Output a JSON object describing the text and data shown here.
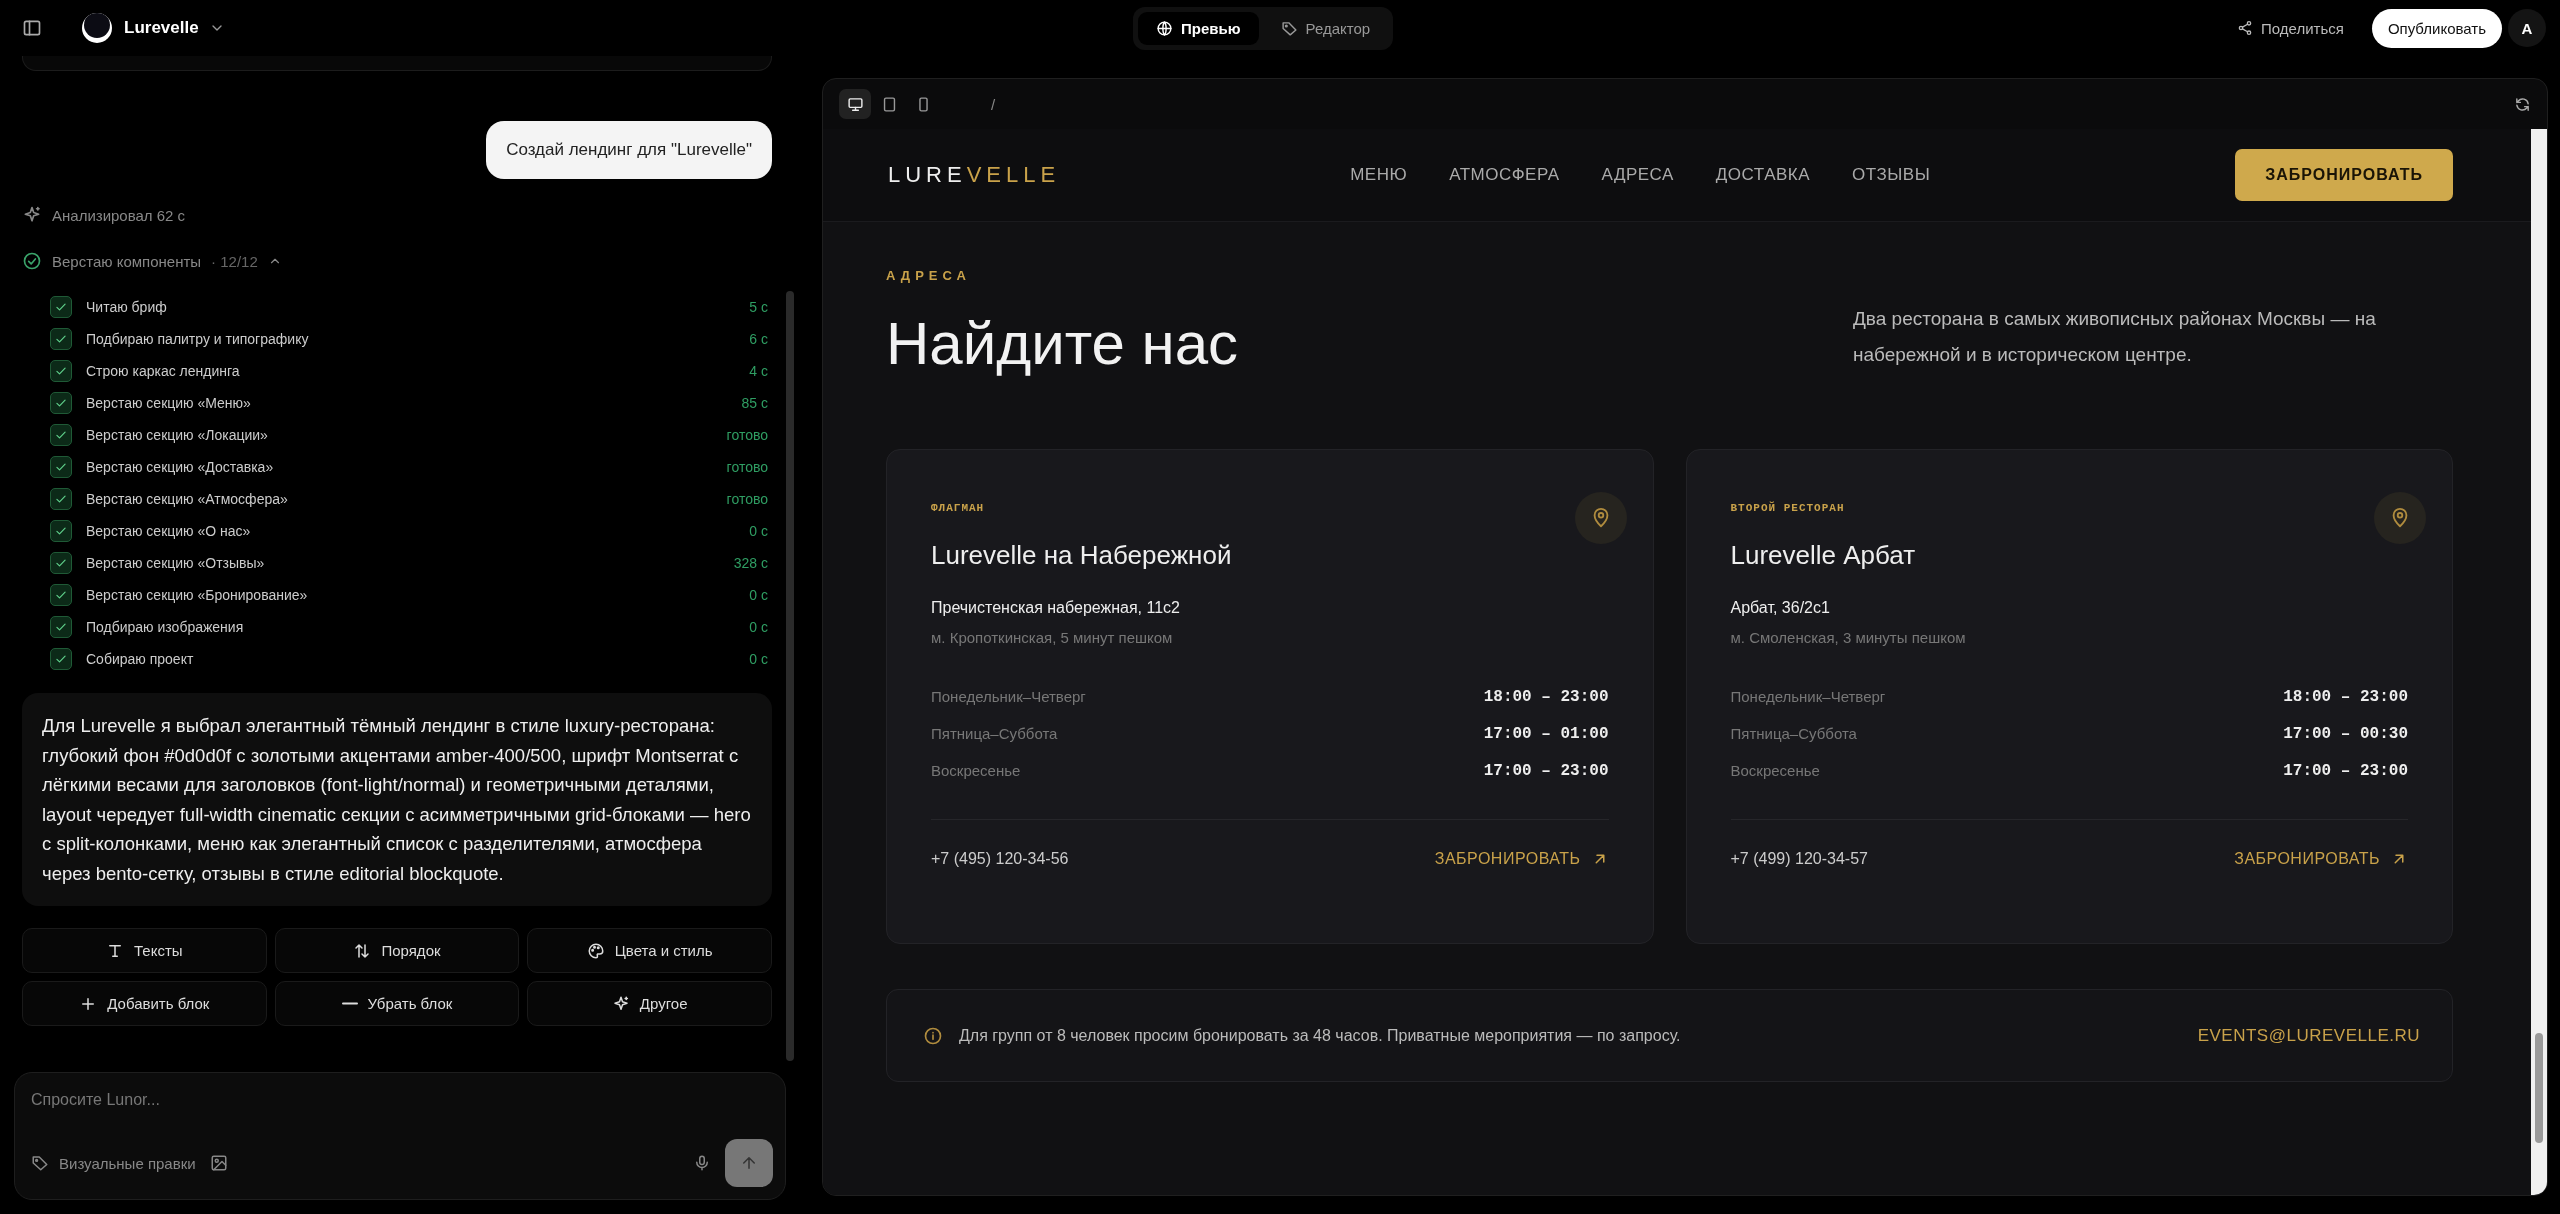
{
  "topbar": {
    "project_name": "Lurevelle",
    "view_tabs": [
      {
        "label": "Превью",
        "selected": true
      },
      {
        "label": "Редактор",
        "selected": false
      }
    ],
    "share": "Поделиться",
    "publish": "Опубликовать",
    "avatar": "A"
  },
  "chat": {
    "user_message": "Создай лендинг для \"Lurevelle\"",
    "thinking": "Анализировал 62 с",
    "task_group": {
      "title": "Верстаю компоненты",
      "count": "· 12/12",
      "expanded": true
    },
    "tasks": [
      {
        "label": "Читаю бриф",
        "time": "5 с",
        "checked": true
      },
      {
        "label": "Подбираю палитру и типографику",
        "time": "6 с",
        "checked": true
      },
      {
        "label": "Строю каркас лендинга",
        "time": "4 с",
        "checked": true
      },
      {
        "label": "Верстаю секцию «Меню»",
        "time": "85 с",
        "checked": true
      },
      {
        "label": "Верстаю секцию «Локации»",
        "time": "готово",
        "checked": true
      },
      {
        "label": "Верстаю секцию «Доставка»",
        "time": "готово",
        "checked": true
      },
      {
        "label": "Верстаю секцию «Атмосфера»",
        "time": "готово",
        "checked": true
      },
      {
        "label": "Верстаю секцию «О нас»",
        "time": "0 с",
        "checked": true
      },
      {
        "label": "Верстаю секцию «Отзывы»",
        "time": "328 с",
        "checked": true
      },
      {
        "label": "Верстаю секцию «Бронирование»",
        "time": "0 с",
        "checked": true
      },
      {
        "label": "Подбираю изображения",
        "time": "0 с",
        "checked": true
      },
      {
        "label": "Собираю проект",
        "time": "0 с",
        "checked": true
      }
    ],
    "reply": "Для Lurevelle я выбрал элегантный тёмный лендинг в стиле luxury-ресторана: глубокий фон #0d0d0f с золотыми акцентами amber-400/500, шрифт Montserrat с лёгкими весами для заголовков (font-light/normal) и геометричными деталями, layout чередует full-width cinematic секции с асимметричными grid-блоками — hero с split-колонками, меню как элегантный список с разделителями, атмосфера через bento-сетку, отзывы в стиле editorial blockquote.",
    "actions": [
      "Тексты",
      "Порядок",
      "Цвета и стиль",
      "Добавить блок",
      "Убрать блок",
      "Другое"
    ],
    "input": {
      "placeholder": "Спросите Lunor..."
    },
    "visual_edits": "Визуальные правки"
  },
  "preview": {
    "device_buttons": [
      {
        "selected": true
      },
      {
        "selected": false
      },
      {
        "selected": false
      }
    ],
    "path": "/",
    "site": {
      "logo_light": "LURE",
      "logo_accent": "VELLE",
      "links": [
        "МЕНЮ",
        "АТМОСФЕРА",
        "АДРЕСА",
        "ДОСТАВКА",
        "ОТЗЫВЫ"
      ],
      "cta": "ЗАБРОНИРОВАТЬ",
      "eyebrow": "АДРЕСА",
      "heading": "Найдите нас",
      "description": "Два ресторана в самых живописных районах Москвы — на набережной и в историческом центре.",
      "locations": [
        {
          "tag": "ФЛАГМАН",
          "name": "Lurevelle на Набережной",
          "address": "Пречистенская набережная, 11с2",
          "metro": "м. Кропоткинская, 5 минут пешком",
          "hours": [
            {
              "days": "Понедельник–Четверг",
              "time": "18:00 – 23:00"
            },
            {
              "days": "Пятница–Суббота",
              "time": "17:00 – 01:00"
            },
            {
              "days": "Воскресенье",
              "time": "17:00 – 23:00"
            }
          ],
          "phone": "+7 (495) 120-34-56",
          "cta": "ЗАБРОНИРОВАТЬ"
        },
        {
          "tag": "ВТОРОЙ РЕСТОРАН",
          "name": "Lurevelle Арбат",
          "address": "Арбат, 36/2с1",
          "metro": "м. Смоленская, 3 минуты пешком",
          "hours": [
            {
              "days": "Понедельник–Четверг",
              "time": "18:00 – 23:00"
            },
            {
              "days": "Пятница–Суббота",
              "time": "17:00 – 00:30"
            },
            {
              "days": "Воскресенье",
              "time": "17:00 – 23:00"
            }
          ],
          "phone": "+7 (499) 120-34-57",
          "cta": "ЗАБРОНИРОВАТЬ"
        }
      ],
      "notice": {
        "text": "Для групп от 8 человек просим бронировать за 48 часов. Приватные мероприятия — по запросу.",
        "email": "EVENTS@LUREVELLE.RU"
      }
    }
  }
}
